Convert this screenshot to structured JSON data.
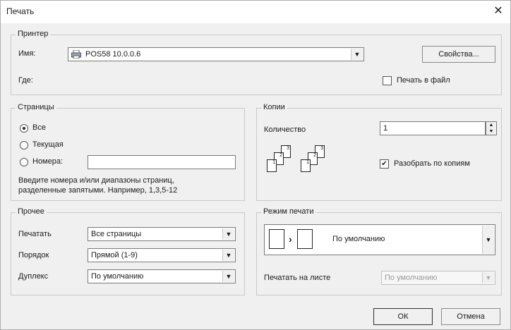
{
  "window": {
    "title": "Печать",
    "close_glyph": "✕"
  },
  "printer": {
    "legend": "Принтер",
    "name_label": "Имя:",
    "name_value": "POS58 10.0.0.6",
    "where_label": "Где:",
    "properties_button": "Свойства...",
    "print_to_file_label": "Печать в файл",
    "print_to_file_checked": false
  },
  "pages": {
    "legend": "Страницы",
    "option_all": "Все",
    "option_current": "Текущая",
    "option_numbers": "Номера:",
    "selected": "all",
    "numbers_value": "",
    "hint_line1": "Введите номера и/или диапазоны страниц,",
    "hint_line2": "разделенные запятыми. Например, 1,3,5-12"
  },
  "copies": {
    "legend": "Копии",
    "count_label": "Количество",
    "count_value": "1",
    "collate_label": "Разобрать по копиям",
    "collate_checked": true,
    "page_numbers": [
      "1",
      "2",
      "3"
    ]
  },
  "other": {
    "legend": "Прочее",
    "print_label": "Печатать",
    "print_value": "Все страницы",
    "order_label": "Порядок",
    "order_value": "Прямой (1-9)",
    "duplex_label": "Дуплекс",
    "duplex_value": "По умолчанию"
  },
  "print_mode": {
    "legend": "Режим печати",
    "mode_value": "По умолчанию",
    "preview_glyph": "›",
    "per_sheet_label": "Печатать на листе",
    "per_sheet_value": "По умолчанию"
  },
  "buttons": {
    "ok": "ОК",
    "cancel": "Отмена"
  },
  "icons": {
    "dropdown": "▼",
    "spin_up": "▲",
    "spin_down": "▼",
    "check": "✔"
  }
}
